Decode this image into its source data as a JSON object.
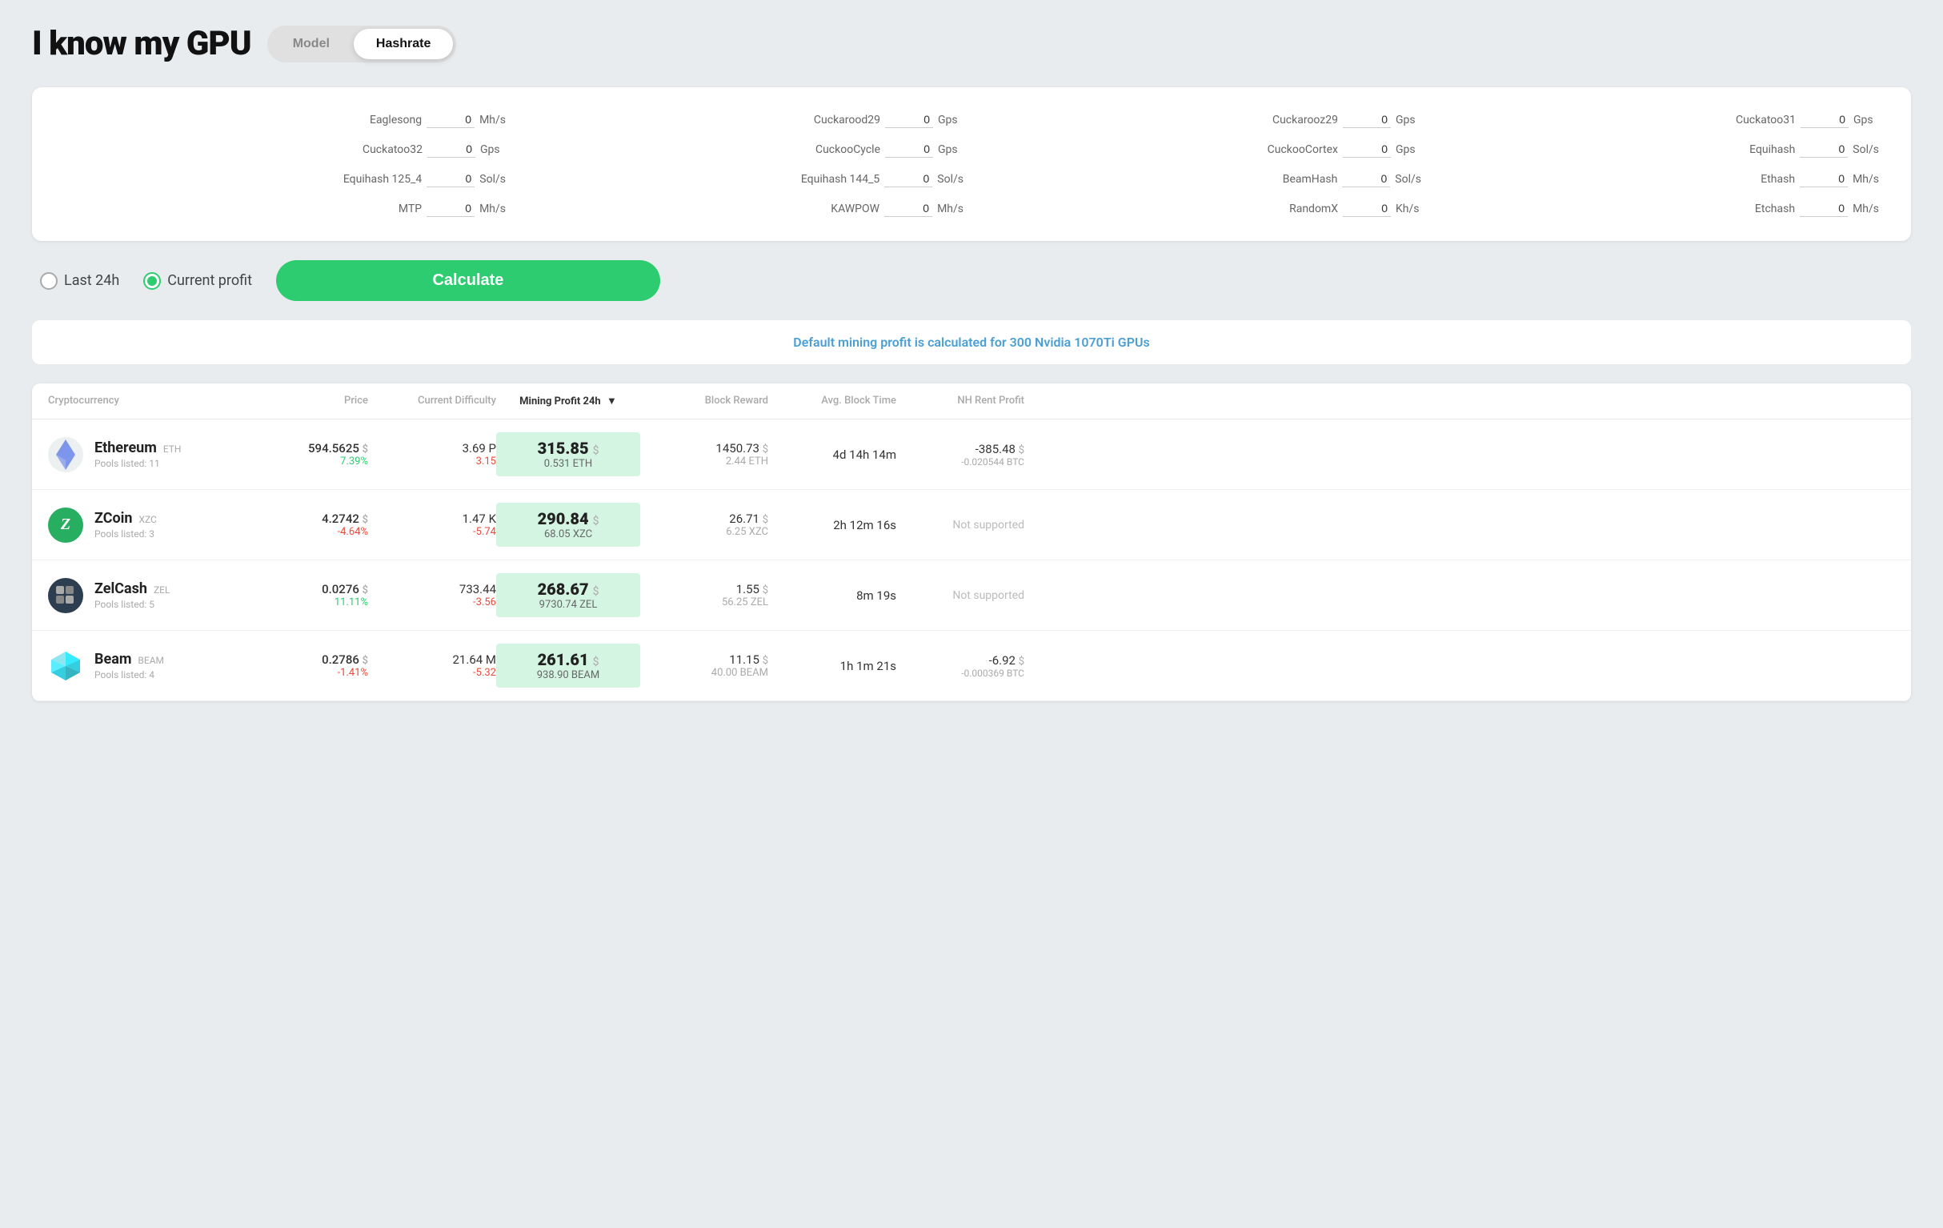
{
  "header": {
    "title": "I know my GPU",
    "toggle_model": "Model",
    "toggle_hashrate": "Hashrate"
  },
  "hashrate_fields": [
    {
      "label": "Eaglesong",
      "value": "0",
      "unit": "Mh/s"
    },
    {
      "label": "Cuckarood29",
      "value": "0",
      "unit": "Gps"
    },
    {
      "label": "Cuckarooz29",
      "value": "0",
      "unit": "Gps"
    },
    {
      "label": "Cuckatoo31",
      "value": "0",
      "unit": "Gps"
    },
    {
      "label": "Cuckatoo32",
      "value": "0",
      "unit": "Gps"
    },
    {
      "label": "CuckooCycle",
      "value": "0",
      "unit": "Gps"
    },
    {
      "label": "CuckooCortex",
      "value": "0",
      "unit": "Gps"
    },
    {
      "label": "Equihash",
      "value": "0",
      "unit": "Sol/s"
    },
    {
      "label": "Equihash 125_4",
      "value": "0",
      "unit": "Sol/s"
    },
    {
      "label": "Equihash 144_5",
      "value": "0",
      "unit": "Sol/s"
    },
    {
      "label": "BeamHash",
      "value": "0",
      "unit": "Sol/s"
    },
    {
      "label": "Ethash",
      "value": "0",
      "unit": "Mh/s"
    },
    {
      "label": "MTP",
      "value": "0",
      "unit": "Mh/s"
    },
    {
      "label": "KAWPOW",
      "value": "0",
      "unit": "Mh/s"
    },
    {
      "label": "RandomX",
      "value": "0",
      "unit": "Kh/s"
    },
    {
      "label": "Etchash",
      "value": "0",
      "unit": "Mh/s"
    }
  ],
  "controls": {
    "radio_last24h": "Last 24h",
    "radio_current": "Current profit",
    "calculate_btn": "Calculate"
  },
  "info_banner": "Default mining profit is calculated for 300 Nvidia 1070Ti GPUs",
  "table": {
    "headers": {
      "cryptocurrency": "Cryptocurrency",
      "price": "Price",
      "difficulty": "Current Difficulty",
      "profit": "Mining Profit 24h",
      "block_reward": "Block Reward",
      "avg_block_time": "Avg. Block Time",
      "nh_rent": "NH Rent Profit"
    },
    "rows": [
      {
        "coin": "Ethereum",
        "ticker": "ETH",
        "pools": "Pools listed: 11",
        "price": "594.5625",
        "price_usd": "$",
        "price_change": "7.39%",
        "price_change_positive": true,
        "difficulty": "3.69 P",
        "diff_change": "3.15",
        "diff_change_negative": true,
        "profit_main": "315.85",
        "profit_usd": "$",
        "profit_sub": "0.531 ETH",
        "block_reward_main": "1450.73",
        "block_reward_usd": "$",
        "block_reward_sub": "2.44 ETH",
        "avg_block_time": "4d 14h 14m",
        "nh_main": "-385.48",
        "nh_usd": "$",
        "nh_sub": "-0.020544 BTC"
      },
      {
        "coin": "ZCoin",
        "ticker": "XZC",
        "pools": "Pools listed: 3",
        "price": "4.2742",
        "price_usd": "$",
        "price_change": "-4.64%",
        "price_change_positive": false,
        "difficulty": "1.47 K",
        "diff_change": "-5.74",
        "diff_change_negative": true,
        "profit_main": "290.84",
        "profit_usd": "$",
        "profit_sub": "68.05 XZC",
        "block_reward_main": "26.71",
        "block_reward_usd": "$",
        "block_reward_sub": "6.25 XZC",
        "avg_block_time": "2h 12m 16s",
        "nh_main": "Not supported",
        "nh_sub": ""
      },
      {
        "coin": "ZelCash",
        "ticker": "ZEL",
        "pools": "Pools listed: 5",
        "price": "0.0276",
        "price_usd": "$",
        "price_change": "11.11%",
        "price_change_positive": true,
        "difficulty": "733.44",
        "diff_change": "-3.56",
        "diff_change_negative": true,
        "profit_main": "268.67",
        "profit_usd": "$",
        "profit_sub": "9730.74 ZEL",
        "block_reward_main": "1.55",
        "block_reward_usd": "$",
        "block_reward_sub": "56.25 ZEL",
        "avg_block_time": "8m 19s",
        "nh_main": "Not supported",
        "nh_sub": ""
      },
      {
        "coin": "Beam",
        "ticker": "BEAM",
        "pools": "Pools listed: 4",
        "price": "0.2786",
        "price_usd": "$",
        "price_change": "-1.41%",
        "price_change_positive": false,
        "difficulty": "21.64 M",
        "diff_change": "-5.32",
        "diff_change_negative": true,
        "profit_main": "261.61",
        "profit_usd": "$",
        "profit_sub": "938.90 BEAM",
        "block_reward_main": "11.15",
        "block_reward_usd": "$",
        "block_reward_sub": "40.00 BEAM",
        "avg_block_time": "1h 1m 21s",
        "nh_main": "-6.92",
        "nh_usd": "$",
        "nh_sub": "-0.000369 BTC"
      }
    ]
  },
  "colors": {
    "green": "#2ecc71",
    "red": "#e74c3c",
    "profit_bg": "#d5f5e3",
    "blue_info": "#4a9fd4"
  }
}
